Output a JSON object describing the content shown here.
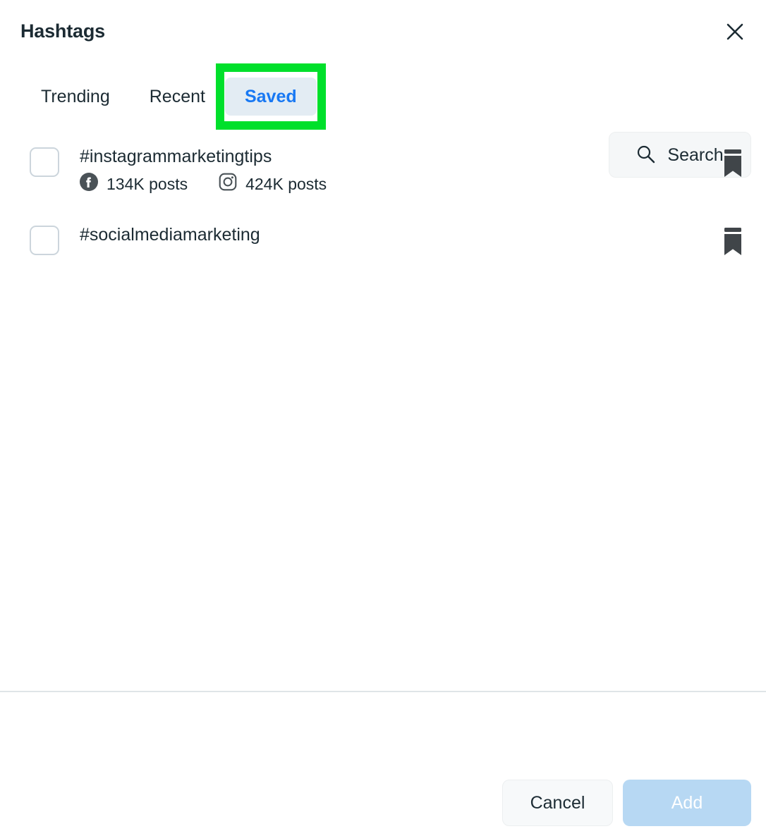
{
  "dialog": {
    "title": "Hashtags",
    "close_icon": "close-icon"
  },
  "tabs": [
    {
      "id": "trending",
      "label": "Trending",
      "active": false
    },
    {
      "id": "recent",
      "label": "Recent",
      "active": false
    },
    {
      "id": "saved",
      "label": "Saved",
      "active": true
    }
  ],
  "search": {
    "label": "Search",
    "icon": "search-icon"
  },
  "annotation": {
    "target": "saved-tab",
    "color": "#00e02b"
  },
  "list": {
    "items": [
      {
        "hashtag": "#instagrammarketingtips",
        "checked": false,
        "bookmarked": true,
        "stats": [
          {
            "network": "facebook",
            "icon": "facebook-icon",
            "count": "134K posts"
          },
          {
            "network": "instagram",
            "icon": "instagram-icon",
            "count": "424K posts"
          }
        ]
      },
      {
        "hashtag": "#socialmediamarketing",
        "checked": false,
        "bookmarked": true,
        "stats": []
      }
    ]
  },
  "footer": {
    "cancel_label": "Cancel",
    "add_label": "Add",
    "add_disabled": true
  },
  "colors": {
    "accent": "#1878f3",
    "active_tab_bg": "#e3ecf3",
    "text": "#1c2b33",
    "annotation": "#00e02b",
    "add_disabled_bg": "#b7d8f3"
  }
}
